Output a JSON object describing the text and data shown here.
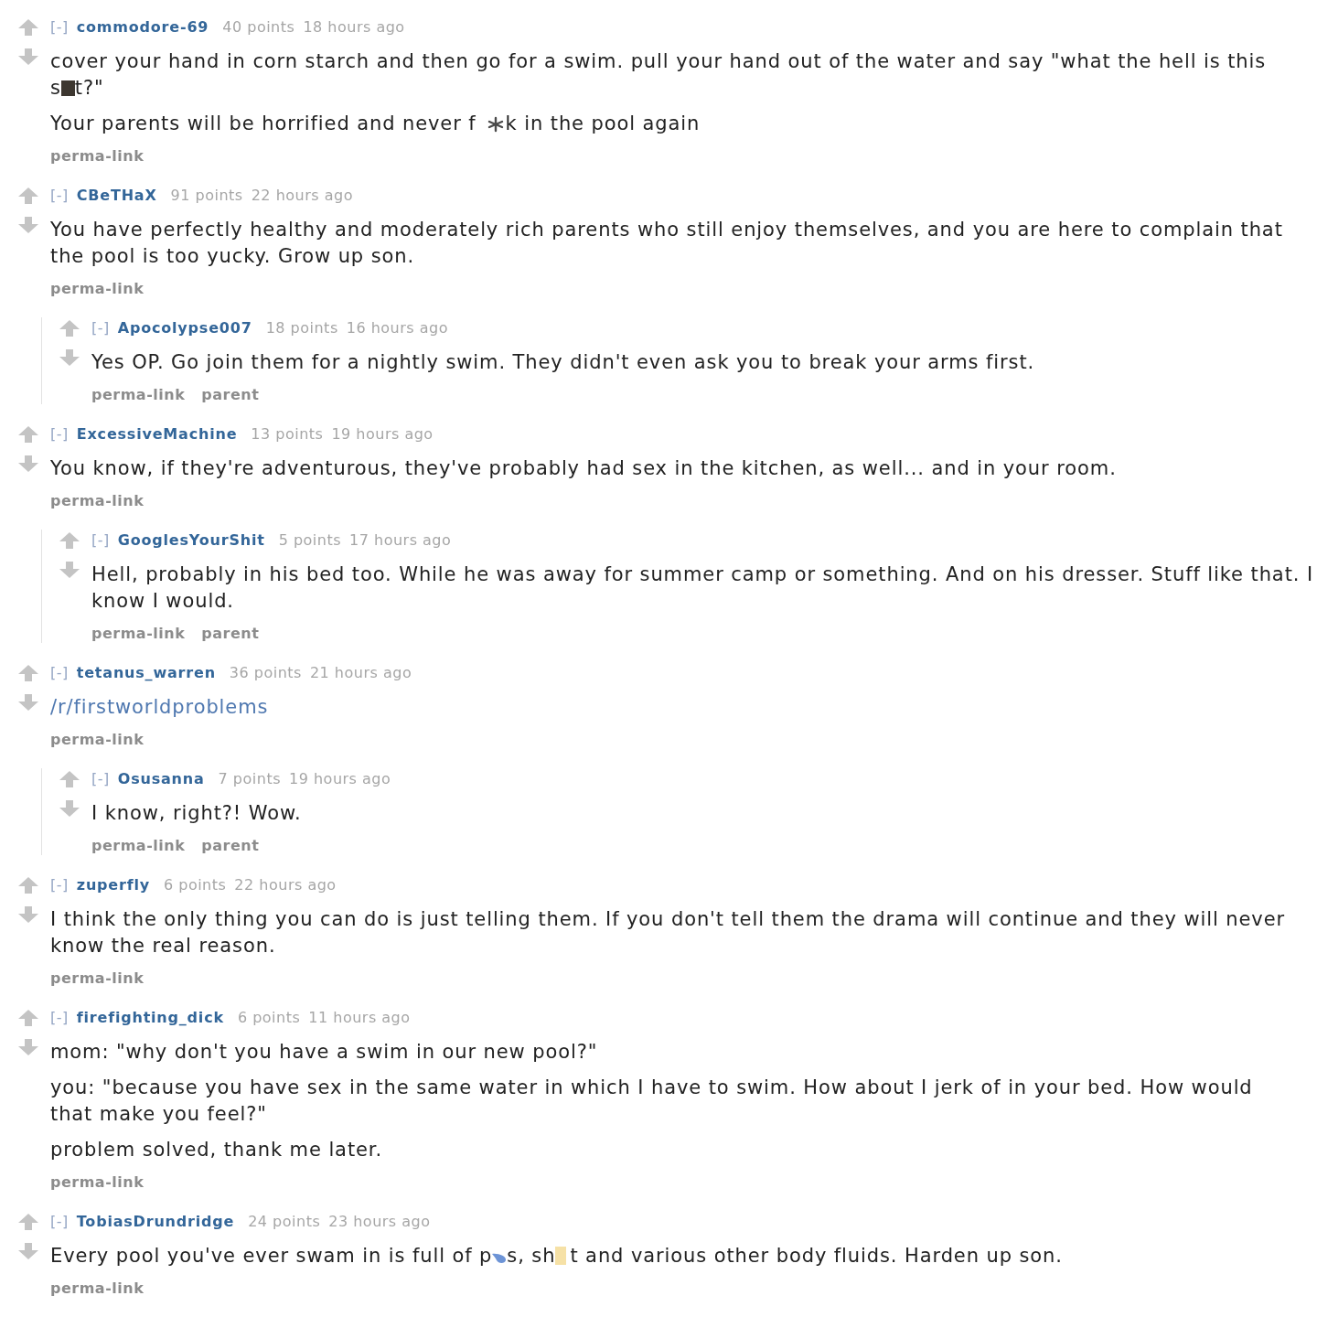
{
  "comments": [
    {
      "collapse": "[-]",
      "author": "commodore-69",
      "score": "40 points",
      "age": "18 hours ago",
      "paragraphs": [
        [
          {
            "kind": "text",
            "text": "cover your hand in corn starch and then go for a swim. pull your hand out of the water and say \"what the hell is this s"
          },
          {
            "kind": "block"
          },
          {
            "kind": "text",
            "text": "t?\""
          }
        ],
        [
          {
            "kind": "text",
            "text": "Your parents will be horrified and never f"
          },
          {
            "kind": "splat"
          },
          {
            "kind": "text",
            "text": "k in the pool again"
          }
        ]
      ],
      "links": [
        "perma-link"
      ]
    },
    {
      "collapse": "[-]",
      "author": "CBeTHaX",
      "score": "91 points",
      "age": "22 hours ago",
      "paragraphs": [
        [
          {
            "kind": "text",
            "text": "You have perfectly healthy and moderately rich parents who still enjoy themselves, and you are here to complain that the pool is too yucky. Grow up son."
          }
        ]
      ],
      "links": [
        "perma-link"
      ],
      "children": [
        {
          "collapse": "[-]",
          "author": "Apocolypse007",
          "score": "18 points",
          "age": "16 hours ago",
          "paragraphs": [
            [
              {
                "kind": "text",
                "text": "Yes OP. Go join them for a nightly swim. They didn't even ask you to break your arms first."
              }
            ]
          ],
          "links": [
            "perma-link",
            "parent"
          ]
        }
      ]
    },
    {
      "collapse": "[-]",
      "author": "ExcessiveMachine",
      "score": "13 points",
      "age": "19 hours ago",
      "paragraphs": [
        [
          {
            "kind": "text",
            "text": "You know, if they're adventurous, they've probably had sex in the kitchen, as well... and in your room."
          }
        ]
      ],
      "links": [
        "perma-link"
      ],
      "children": [
        {
          "collapse": "[-]",
          "author": "GooglesYourShit",
          "score": "5 points",
          "age": "17 hours ago",
          "paragraphs": [
            [
              {
                "kind": "text",
                "text": "Hell, probably in his bed too. While he was away for summer camp or something. And on his dresser. Stuff like that. I know I would."
              }
            ]
          ],
          "links": [
            "perma-link",
            "parent"
          ]
        }
      ]
    },
    {
      "collapse": "[-]",
      "author": "tetanus_warren",
      "score": "36 points",
      "age": "21 hours ago",
      "paragraphs": [
        [
          {
            "kind": "link",
            "text": "/r/firstworldproblems"
          }
        ]
      ],
      "links": [
        "perma-link"
      ],
      "children": [
        {
          "collapse": "[-]",
          "author": "Osusanna",
          "score": "7 points",
          "age": "19 hours ago",
          "paragraphs": [
            [
              {
                "kind": "text",
                "text": "I know, right?! Wow."
              }
            ]
          ],
          "links": [
            "perma-link",
            "parent"
          ]
        }
      ]
    },
    {
      "collapse": "[-]",
      "author": "zuperfly",
      "score": "6 points",
      "age": "22 hours ago",
      "paragraphs": [
        [
          {
            "kind": "text",
            "text": "I think the only thing you can do is just telling them. If you don't tell them the drama will continue and they will never know the real reason."
          }
        ]
      ],
      "links": [
        "perma-link"
      ]
    },
    {
      "collapse": "[-]",
      "author": "firefighting_dick",
      "score": "6 points",
      "age": "11 hours ago",
      "paragraphs": [
        [
          {
            "kind": "text",
            "text": "mom: \"why don't you have a swim in our new pool?\""
          }
        ],
        [
          {
            "kind": "text",
            "text": "you: \"because you have sex in the same water in which I have to swim. How about I jerk of in your bed. How would that make you feel?\""
          }
        ],
        [
          {
            "kind": "text",
            "text": "problem solved, thank me later."
          }
        ]
      ],
      "links": [
        "perma-link"
      ]
    },
    {
      "collapse": "[-]",
      "author": "TobiasDrundridge",
      "score": "24 points",
      "age": "23 hours ago",
      "paragraphs": [
        [
          {
            "kind": "text",
            "text": "Every pool you've ever swam in is full of p"
          },
          {
            "kind": "droplet"
          },
          {
            "kind": "text",
            "text": "s, sh"
          },
          {
            "kind": "patch"
          },
          {
            "kind": "text",
            "text": "t and various other body fluids. Harden up son."
          }
        ]
      ],
      "links": [
        "perma-link"
      ]
    }
  ]
}
